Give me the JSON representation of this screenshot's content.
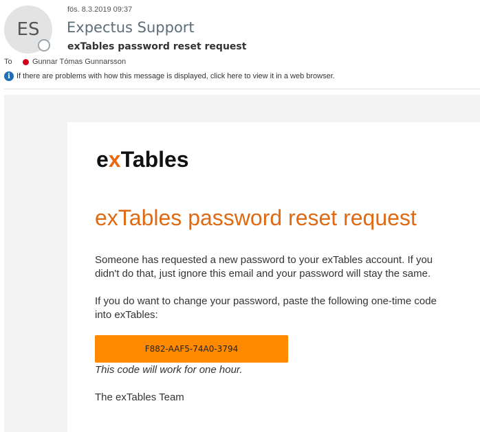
{
  "header": {
    "avatar_initials": "ES",
    "date": "fös. 8.3.2019 09:37",
    "sender": "Expectus Support",
    "subject": "exTables password reset request",
    "to_label": "To",
    "recipient": "Gunnar Tómas Gunnarsson",
    "info_message": "If there are problems with how this message is displayed, click here to view it in a web browser."
  },
  "email": {
    "logo_prefix": "e",
    "logo_x": "x",
    "logo_suffix": "Tables",
    "headline": "exTables password reset request",
    "paragraph1": "Someone has requested a new password to your exTables account. If you didn't do that, just ignore this email and your password will stay the same.",
    "paragraph2": "If you do want to change your password, paste the following one-time code into exTables:",
    "code": "F882-AAF5-74A0-3794",
    "code_note": "This code will work for one hour.",
    "signature": "The exTables Team"
  },
  "colors": {
    "accent_orange": "#ff8a00",
    "headline_orange": "#e06a12",
    "presence_red": "#d0021b",
    "info_blue": "#1f6fb5"
  }
}
